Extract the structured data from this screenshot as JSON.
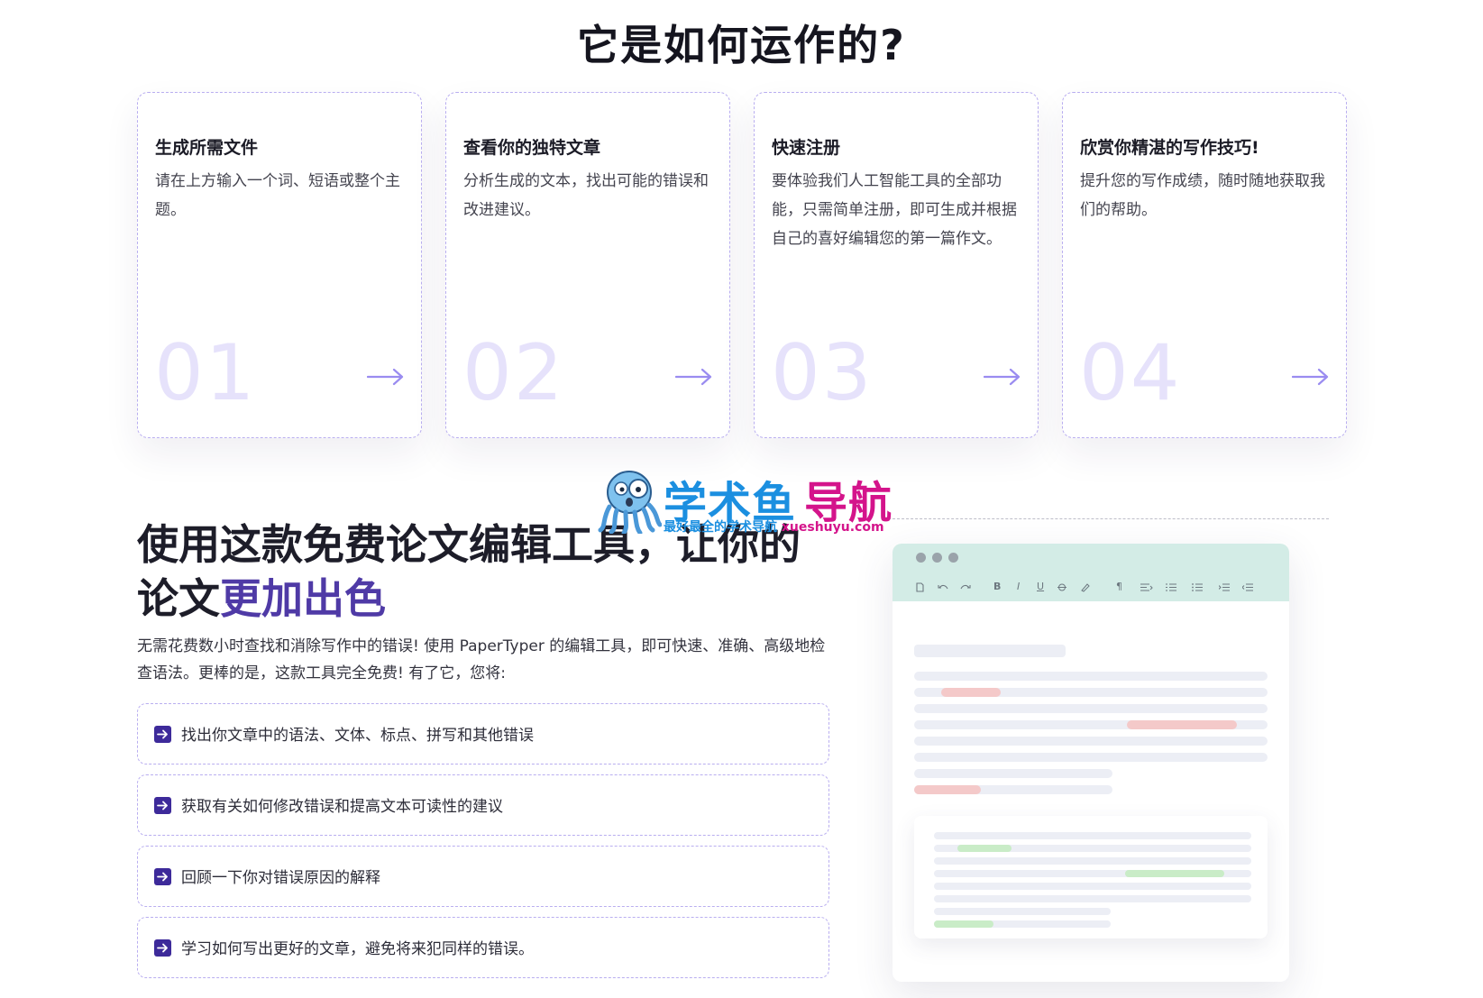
{
  "section_title": "它是如何运作的?",
  "steps": [
    {
      "title": "生成所需文件",
      "desc": "请在上方输入一个词、短语或整个主题。",
      "num": "01"
    },
    {
      "title": "查看你的独特文章",
      "desc": "分析生成的文本，找出可能的错误和改进建议。",
      "num": "02"
    },
    {
      "title": "快速注册",
      "desc": "要体验我们人工智能工具的全部功能，只需简单注册，即可生成并根据自己的喜好编辑您的第一篇作文。",
      "num": "03"
    },
    {
      "title": "欣赏你精湛的写作技巧!",
      "desc": "提升您的写作成绩，随时随地获取我们的帮助。",
      "num": "04"
    }
  ],
  "watermark": {
    "name_part1": "学术鱼",
    "name_part2": "导航",
    "tagline": "最好最全的学术导航",
    "domain": "xueshuyu.com"
  },
  "headline": {
    "line1": "使用这款免费论文编辑工具，让你的",
    "line2_plain": "论文",
    "line2_accent": "更加出色"
  },
  "intro": "无需花费数小时查找和消除写作中的错误! 使用 PaperTyper 的编辑工具，即可快速、准确、高级地检查语法。更棒的是，这款工具完全免费! 有了它，您将:",
  "features": [
    "找出你文章中的语法、文体、标点、拼写和其他错误",
    "获取有关如何修改错误和提高文本可读性的建议",
    "回顾一下你对错误原因的解释",
    "学习如何写出更好的文章，避免将来犯同样的错误。"
  ],
  "editor_toolbar": {
    "bold": "B",
    "italic": "I",
    "underline": "U",
    "paragraph": "¶",
    "icons": [
      "document-icon",
      "undo-icon",
      "redo-icon",
      "bold-icon",
      "italic-icon",
      "underline-icon",
      "strikethrough-icon",
      "highlighter-icon",
      "paragraph-icon",
      "align-icon",
      "ordered-list-icon",
      "unordered-list-icon",
      "indent-icon",
      "outdent-icon"
    ]
  },
  "colors": {
    "accent": "#4f3aa6",
    "card_border": "#b9aef0",
    "step_number": "#e6e2fb",
    "arrow": "#9a8cf0",
    "feature_icon_bg": "#3d2a9a",
    "editor_top": "#d3ece6",
    "error_highlight": "#f4c9c9",
    "fix_highlight": "#c9ecc7"
  }
}
